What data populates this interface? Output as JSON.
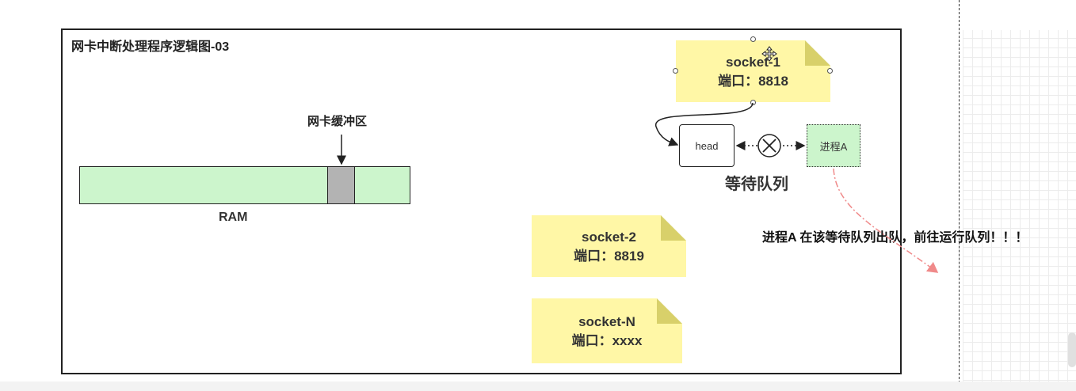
{
  "diagram": {
    "title": "网卡中断处理程序逻辑图-03",
    "ram_label": "RAM",
    "buffer_label": "网卡缓冲区",
    "sockets": [
      {
        "name": "socket-1",
        "port_line": "端口：8818"
      },
      {
        "name": "socket-2",
        "port_line": "端口：8819"
      },
      {
        "name": "socket-N",
        "port_line": "端口：xxxx"
      }
    ],
    "queue": {
      "head_label": "head",
      "process_label": "进程A",
      "queue_label": "等待队列"
    },
    "dequeue_note": "进程A 在该等待队列出队，前往运行队列！！！",
    "colors": {
      "ram_fill": "#ccf5cc",
      "buffer_fill": "#b3b3b3",
      "note_fill": "#fff7a6",
      "process_fill": "#ccf5cc",
      "dequeue_arrow": "#f08a8a"
    }
  }
}
